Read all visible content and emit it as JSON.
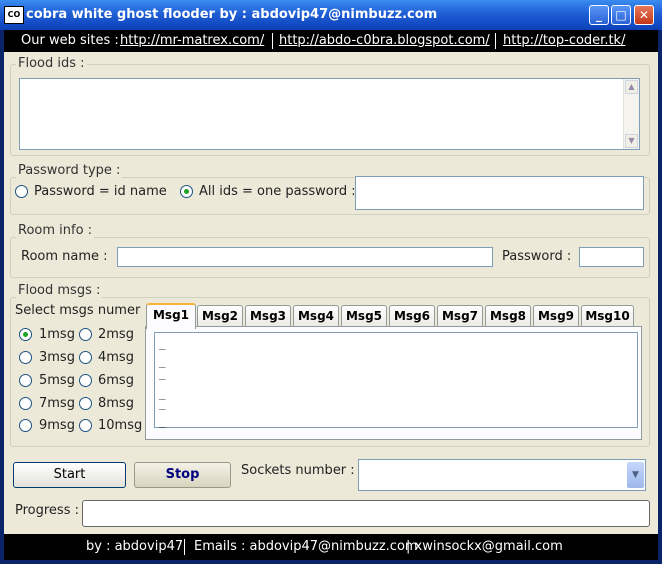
{
  "window": {
    "title": "cobra white ghost flooder by : abdovip47@nimbuzz.com",
    "icon_text": "CO",
    "controls": {
      "minimize": "_",
      "maximize": "□",
      "close": "✕"
    }
  },
  "links": {
    "label": "Our web sites :",
    "items": [
      "http://mr-matrex.com/",
      "http://abdo-c0bra.blogspot.com/",
      "http://top-coder.tk/"
    ]
  },
  "flood_ids": {
    "label": "Flood ids :",
    "value": ""
  },
  "password_type": {
    "label": "Password type :",
    "option1": "Password = id name",
    "option2": "All ids = one password :",
    "selected": "option2",
    "value": ""
  },
  "room_info": {
    "label": "Room info :",
    "room_name_label": "Room name :",
    "room_name": "",
    "password_label": "Password :",
    "password": ""
  },
  "flood_msgs": {
    "label": "Flood msgs :",
    "select_label": "Select msgs numer",
    "options": [
      "1msg",
      "2msg",
      "3msg",
      "4msg",
      "5msg",
      "6msg",
      "7msg",
      "8msg",
      "9msg",
      "10msg"
    ],
    "selected": "1msg",
    "tabs": [
      "Msg1",
      "Msg2",
      "Msg3",
      "Msg4",
      "Msg5",
      "Msg6",
      "Msg7",
      "Msg8",
      "Msg9",
      "Msg10"
    ],
    "active_tab": "Msg1",
    "message_lines": [
      "_",
      "_",
      "_",
      "_",
      "_",
      "_"
    ]
  },
  "actions": {
    "start": "Start",
    "stop": "Stop",
    "sockets_label": "Sockets number :",
    "sockets_value": ""
  },
  "progress": {
    "label": "Progress :",
    "value": 0
  },
  "footer": {
    "by": "by : abdovip47",
    "emails": "Emails : abdovip47@nimbuzz.com",
    "other": "| xwinsockx@gmail.com"
  },
  "colors": {
    "title_blue": "#1f5fd6",
    "bar_black": "#000000",
    "panel": "#ece9d8",
    "radio_green": "#21a121",
    "tab_accent": "#f8b33a"
  }
}
